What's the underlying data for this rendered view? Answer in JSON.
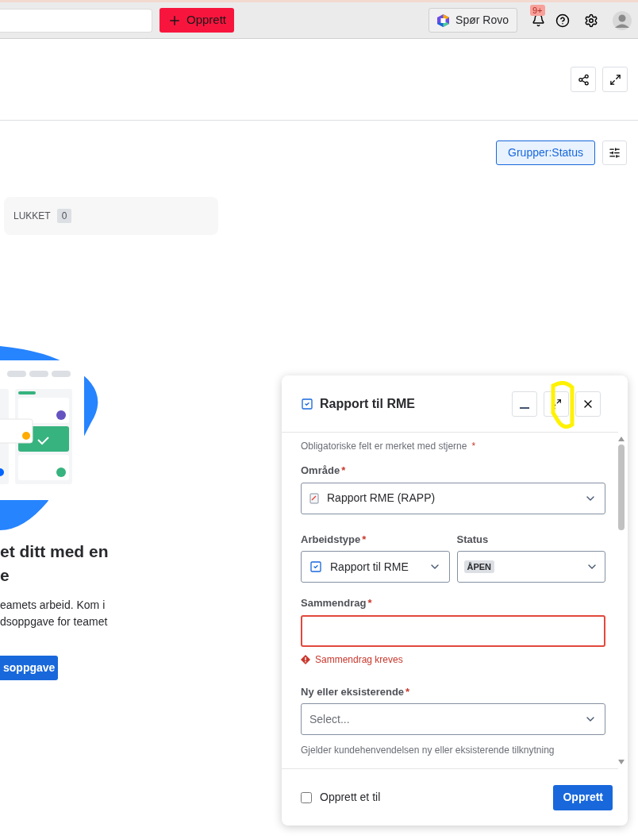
{
  "top_bar": {
    "create_button": "Opprett",
    "ask_button": "Spør Rovo",
    "notification_badge": "9+"
  },
  "group_button": {
    "label": "Grupper:Status",
    "selected": true
  },
  "columns": [
    {
      "title": "LUKKET",
      "count": "0"
    }
  ],
  "empty_state": {
    "heading": [
      "et ditt med en",
      "e"
    ],
    "text": [
      "eamets arbeid. Kom i",
      "dsoppgave for teamet"
    ],
    "button": "soppgave"
  },
  "modal": {
    "title": "Rapport til RME",
    "required_note": "Obligatoriske felt er merket med stjerne",
    "required_mark": "*",
    "rows": [
      [
        {
          "kind": "select",
          "label": "Område",
          "required": true,
          "value": "Rapport RME (RAPP)"
        }
      ],
      [
        {
          "kind": "select",
          "label": "Arbeidstype",
          "required": true,
          "value": "Rapport til RME"
        },
        {
          "kind": "status",
          "label": "Status",
          "required": false,
          "value": "ÅPEN"
        }
      ],
      [
        {
          "kind": "text",
          "label": "Sammendrag",
          "required": true,
          "error": "Sammendrag kreves"
        }
      ],
      [
        {
          "kind": "select",
          "label": "Ny eller eksisterende",
          "required": true,
          "placeholder": "Select...",
          "helper": "Gjelder kundehenvendelsen ny eller eksisterende tilknytning"
        }
      ]
    ],
    "create_another": {
      "label": "Opprett et til",
      "checked": false
    },
    "submit": "Opprett"
  }
}
